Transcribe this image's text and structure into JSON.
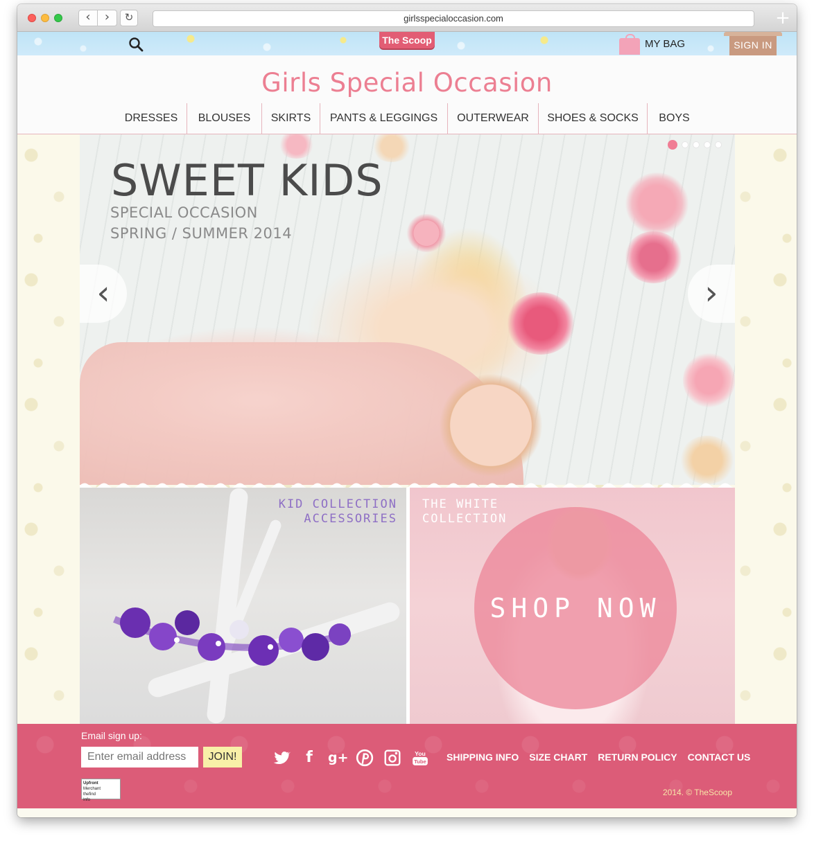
{
  "browser": {
    "url": "girlsspecialoccasion.com",
    "back_glyph": "‹",
    "forward_glyph": "›",
    "reload_glyph": "↻",
    "new_tab_glyph": "+"
  },
  "topbar": {
    "scoop_label": "The Scoop",
    "bag_label": "MY BAG",
    "signin_label": "SIGN IN"
  },
  "header": {
    "site_title": "Girls Special Occasion",
    "nav": [
      "DRESSES",
      "BLOUSES",
      "SKIRTS",
      "PANTS & LEGGINGS",
      "OUTERWEAR",
      "SHOES & SOCKS",
      "BOYS"
    ]
  },
  "hero": {
    "title": "SWEET KIDS",
    "subtitle": "SPECIAL OCCASION",
    "season": "SPRING / SUMMER 2014",
    "slide_count": 5,
    "active_slide": 1,
    "prev_glyph": "‹",
    "next_glyph": "›"
  },
  "tiles": {
    "left_line1": "KID COLLECTION",
    "left_line2": "ACCESSORIES",
    "right_line1": "THE WHITE",
    "right_line2": "COLLECTION",
    "shop_now": "SHOP NOW"
  },
  "footer": {
    "signup_label": "Email sign up:",
    "email_placeholder": "Enter email address",
    "join_label": "JOIN!",
    "badge_line1": "Upfront",
    "badge_line2": "Merchant",
    "badge_line3": "thefind",
    "badge_line4": "Info",
    "social": [
      {
        "name": "twitter-icon",
        "glyph": "🐦"
      },
      {
        "name": "facebook-icon",
        "glyph": "f"
      },
      {
        "name": "google-plus-icon",
        "glyph": "g+"
      },
      {
        "name": "pinterest-icon",
        "glyph": "℗"
      },
      {
        "name": "instagram-icon",
        "glyph": "▣"
      },
      {
        "name": "youtube-icon",
        "glyph": "▶"
      }
    ],
    "links": [
      "SHIPPING INFO",
      "SIZE CHART",
      "RETURN POLICY",
      "CONTACT US"
    ],
    "copyright": "2014. © TheScoop"
  },
  "colors": {
    "brand_pink": "#ec7f92",
    "footer_pink": "#dc5c78",
    "accessories_purple": "#8e6fc5",
    "signin_tan": "#c99a80"
  }
}
